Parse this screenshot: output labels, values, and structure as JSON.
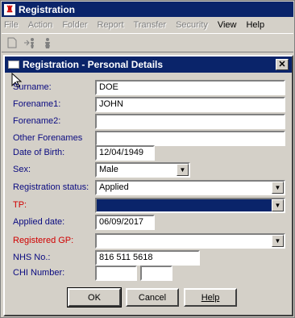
{
  "app": {
    "title": "Registration"
  },
  "menu": [
    {
      "label": "File",
      "disabled": true
    },
    {
      "label": "Action",
      "disabled": true
    },
    {
      "label": "Folder",
      "disabled": true
    },
    {
      "label": "Report",
      "disabled": true
    },
    {
      "label": "Transfer",
      "disabled": true
    },
    {
      "label": "Security",
      "disabled": true
    },
    {
      "label": "View",
      "disabled": false
    },
    {
      "label": "Help",
      "disabled": false
    }
  ],
  "toolbar": {
    "icons": [
      "new-document-icon",
      "transfer-person-icon",
      "person-icon"
    ]
  },
  "dialog": {
    "title": "Registration - Personal Details",
    "close_glyph": "✕"
  },
  "form": {
    "surname": {
      "label": "Surname:",
      "value": "DOE"
    },
    "forename1": {
      "label": "Forename1:",
      "value": "JOHN"
    },
    "forename2": {
      "label": "Forename2:",
      "value": ""
    },
    "other_forenames": {
      "label": "Other Forenames",
      "value": ""
    },
    "dob": {
      "label": "Date of Birth:",
      "value": "12/04/1949"
    },
    "sex": {
      "label": "Sex:",
      "value": "Male"
    },
    "registration_status": {
      "label": "Registration status:",
      "value": "Applied"
    },
    "tp": {
      "label": "TP:",
      "value": ""
    },
    "applied_date": {
      "label": "Applied date:",
      "value": "06/09/2017"
    },
    "registered_gp": {
      "label": "Registered GP:",
      "value": ""
    },
    "nhs_no": {
      "label": "NHS No.:",
      "value": "816 511 5618"
    },
    "chi_number": {
      "label": "CHI Number:",
      "value_a": "",
      "value_b": ""
    }
  },
  "buttons": {
    "ok": "OK",
    "cancel": "Cancel",
    "help": "Help"
  },
  "colors": {
    "title_bg": "#0a246a",
    "label_blue": "#0a0a80",
    "required_red": "#d00000",
    "face": "#d4d0c8"
  }
}
